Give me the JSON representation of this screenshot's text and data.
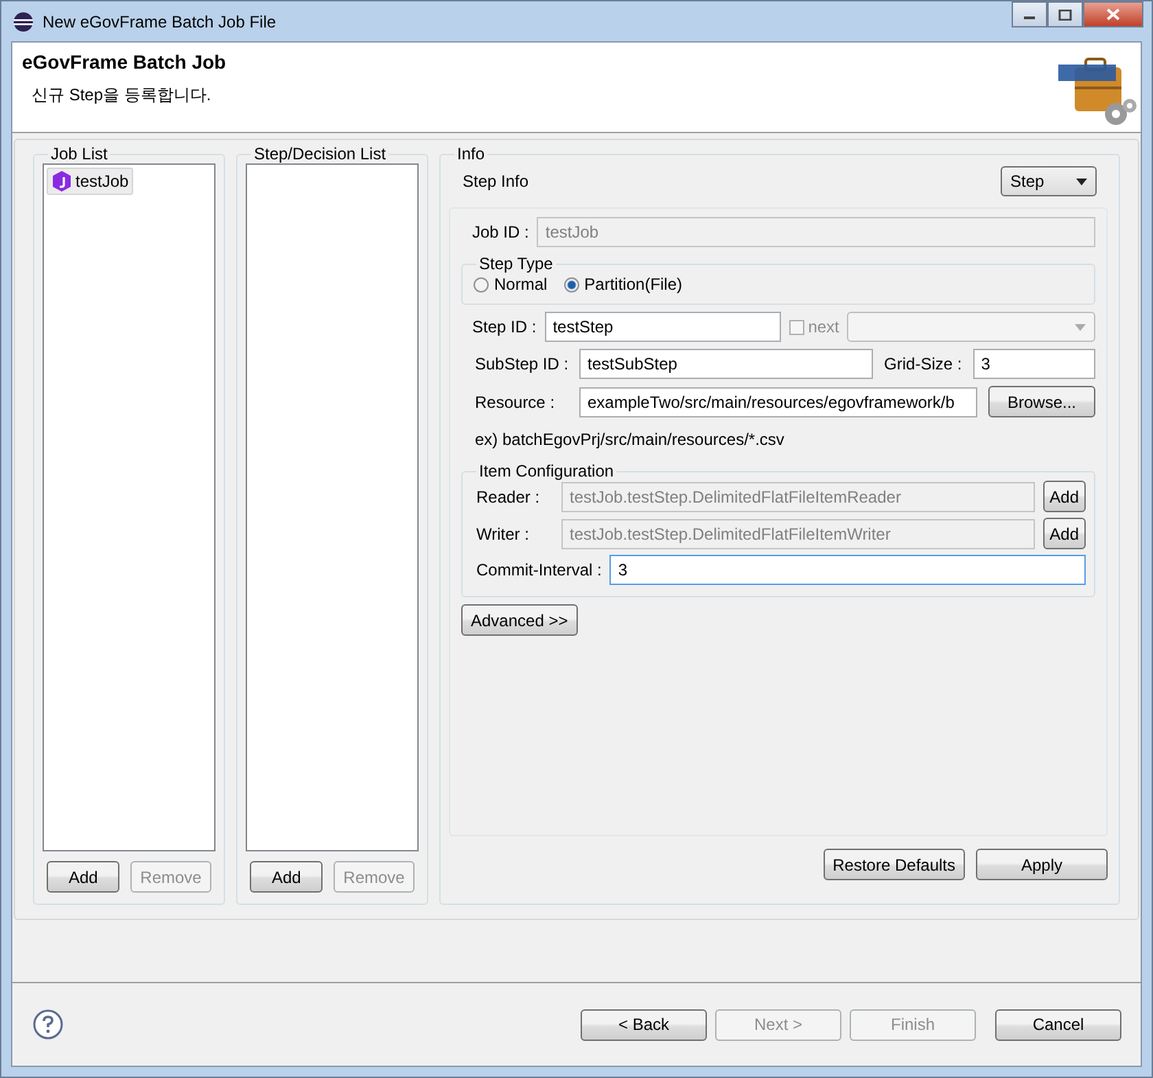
{
  "window": {
    "title": "New eGovFrame Batch Job File"
  },
  "header": {
    "title": "eGovFrame Batch Job",
    "subtitle": "신규 Step을 등록합니다."
  },
  "job_list": {
    "label": "Job List",
    "items": [
      {
        "label": "testJob",
        "selected": true
      }
    ],
    "buttons": [
      {
        "label": "Add",
        "disabled": false
      },
      {
        "label": "Remove",
        "disabled": true
      }
    ]
  },
  "step_list": {
    "label": "Step/Decision List",
    "buttons": [
      {
        "label": "Add",
        "disabled": false
      },
      {
        "label": "Remove",
        "disabled": true
      }
    ]
  },
  "info": {
    "label": "Info",
    "section": "Step Info",
    "type_dropdown": "Step",
    "job_id": {
      "label": "Job ID :",
      "value": "testJob",
      "disabled": true
    },
    "step_type": {
      "label": "Step Type",
      "options": [
        {
          "label": "Normal",
          "selected": false
        },
        {
          "label": "Partition(File)",
          "selected": true
        }
      ]
    },
    "step_id": {
      "label": "Step ID :",
      "value": "testStep"
    },
    "next": {
      "label": "next",
      "checked": false,
      "disabled": true
    },
    "substep_id": {
      "label": "SubStep ID :",
      "value": "testSubStep"
    },
    "grid_size": {
      "label": "Grid-Size :",
      "value": "3"
    },
    "resource": {
      "label": "Resource :",
      "value": "exampleTwo/src/main/resources/egovframework/b",
      "button": "Browse..."
    },
    "example": "ex) batchEgovPrj/src/main/resources/*.csv",
    "item_configuration": {
      "label": "Item Configuration",
      "rows": [
        {
          "label": "Reader :",
          "value": "testJob.testStep.DelimitedFlatFileItemReader",
          "disabled": true,
          "button": "Add"
        },
        {
          "label": "Writer :",
          "value": "testJob.testStep.DelimitedFlatFileItemWriter",
          "disabled": true,
          "button": "Add"
        }
      ],
      "commit_interval": {
        "label": "Commit-Interval :",
        "value": "3",
        "focused": true
      }
    },
    "advanced_button": "Advanced >>",
    "buttons": [
      {
        "label": "Restore Defaults"
      },
      {
        "label": "Apply"
      }
    ]
  },
  "footer": {
    "buttons": [
      {
        "label": "< Back",
        "disabled": false
      },
      {
        "label": "Next >",
        "disabled": true
      },
      {
        "label": "Finish",
        "disabled": true
      },
      {
        "label": "Cancel",
        "disabled": false
      }
    ]
  }
}
